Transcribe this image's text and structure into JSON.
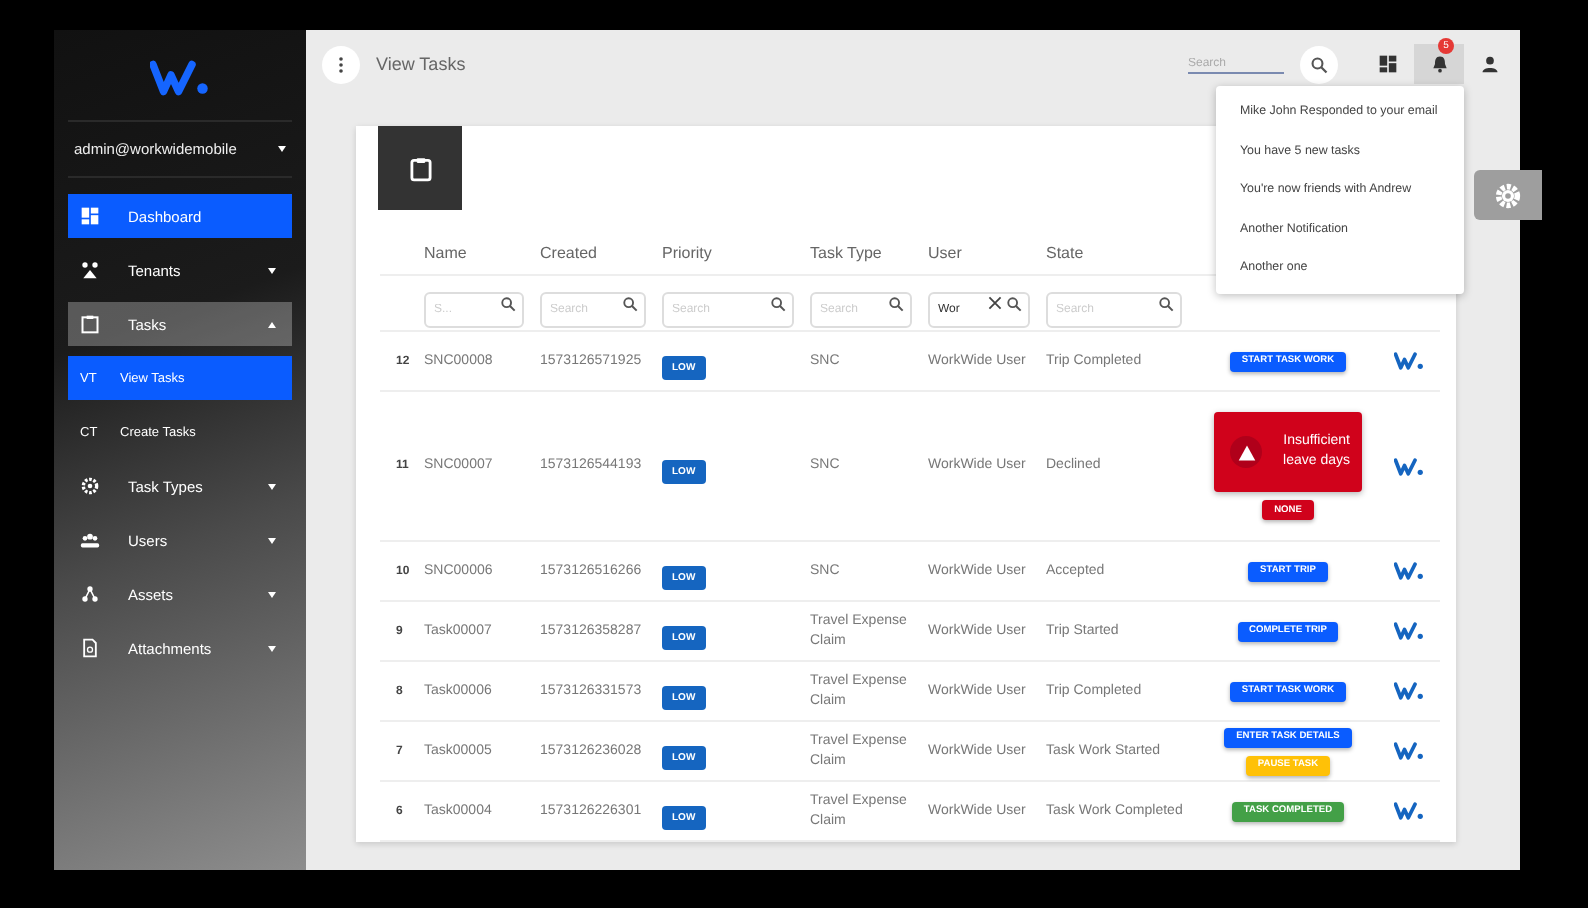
{
  "sidebar": {
    "account": "admin@workwidemobile",
    "items": [
      {
        "label": "Dashboard",
        "kind": "link",
        "selected": true,
        "expanded": false
      },
      {
        "label": "Tenants",
        "kind": "group",
        "selected": false,
        "expanded": false
      },
      {
        "label": "Tasks",
        "kind": "group",
        "selected": false,
        "expanded": true,
        "children": [
          {
            "abbr": "VT",
            "label": "View Tasks",
            "selected": true
          },
          {
            "abbr": "CT",
            "label": "Create Tasks",
            "selected": false
          }
        ]
      },
      {
        "label": "Task Types",
        "kind": "group",
        "selected": false,
        "expanded": false
      },
      {
        "label": "Users",
        "kind": "group",
        "selected": false,
        "expanded": false
      },
      {
        "label": "Assets",
        "kind": "group",
        "selected": false,
        "expanded": false
      },
      {
        "label": "Attachments",
        "kind": "group",
        "selected": false,
        "expanded": false
      }
    ]
  },
  "header": {
    "title": "View Tasks",
    "search": {
      "placeholder": "Search"
    },
    "notification_count": "5"
  },
  "notifications": [
    "Mike John Responded to your email",
    "You have 5 new tasks",
    "You're now friends with Andrew",
    "Another Notification",
    "Another one"
  ],
  "table": {
    "columns": [
      "Name",
      "Created",
      "Priority",
      "Task Type",
      "User",
      "State"
    ],
    "filters": [
      {
        "placeholder": "S..."
      },
      {
        "placeholder": "Search"
      },
      {
        "placeholder": "Search"
      },
      {
        "placeholder": "Search"
      },
      {
        "value": "Wor"
      },
      {
        "placeholder": "Search"
      }
    ],
    "rows": [
      {
        "index": "12",
        "name": "SNC00008",
        "created": "1573126571925",
        "priority": "LOW",
        "task_type": "SNC",
        "user": "WorkWide User",
        "state": "Trip Completed",
        "actions": [
          {
            "label": "START TASK WORK",
            "kind": "primary"
          }
        ]
      },
      {
        "index": "11",
        "name": "SNC00007",
        "created": "1573126544193",
        "priority": "LOW",
        "task_type": "SNC",
        "user": "WorkWide User",
        "state": "Declined",
        "alert": "Insufficient leave days",
        "actions": [
          {
            "label": "NONE",
            "kind": "danger"
          }
        ]
      },
      {
        "index": "10",
        "name": "SNC00006",
        "created": "1573126516266",
        "priority": "LOW",
        "task_type": "SNC",
        "user": "WorkWide User",
        "state": "Accepted",
        "actions": [
          {
            "label": "START TRIP",
            "kind": "primary"
          }
        ]
      },
      {
        "index": "9",
        "name": "Task00007",
        "created": "1573126358287",
        "priority": "LOW",
        "task_type": "Travel Expense Claim",
        "user": "WorkWide User",
        "state": "Trip Started",
        "actions": [
          {
            "label": "COMPLETE TRIP",
            "kind": "primary"
          }
        ]
      },
      {
        "index": "8",
        "name": "Task00006",
        "created": "1573126331573",
        "priority": "LOW",
        "task_type": "Travel Expense Claim",
        "user": "WorkWide User",
        "state": "Trip Completed",
        "actions": [
          {
            "label": "START TASK WORK",
            "kind": "primary"
          }
        ]
      },
      {
        "index": "7",
        "name": "Task00005",
        "created": "1573126236028",
        "priority": "LOW",
        "task_type": "Travel Expense Claim",
        "user": "WorkWide User",
        "state": "Task Work Started",
        "actions": [
          {
            "label": "ENTER TASK DETAILS",
            "kind": "primary"
          },
          {
            "label": "PAUSE TASK",
            "kind": "warning"
          }
        ]
      },
      {
        "index": "6",
        "name": "Task00004",
        "created": "1573126226301",
        "priority": "LOW",
        "task_type": "Travel Expense Claim",
        "user": "WorkWide User",
        "state": "Task Work Completed",
        "actions": [
          {
            "label": "TASK COMPLETED",
            "kind": "success"
          }
        ]
      }
    ]
  }
}
